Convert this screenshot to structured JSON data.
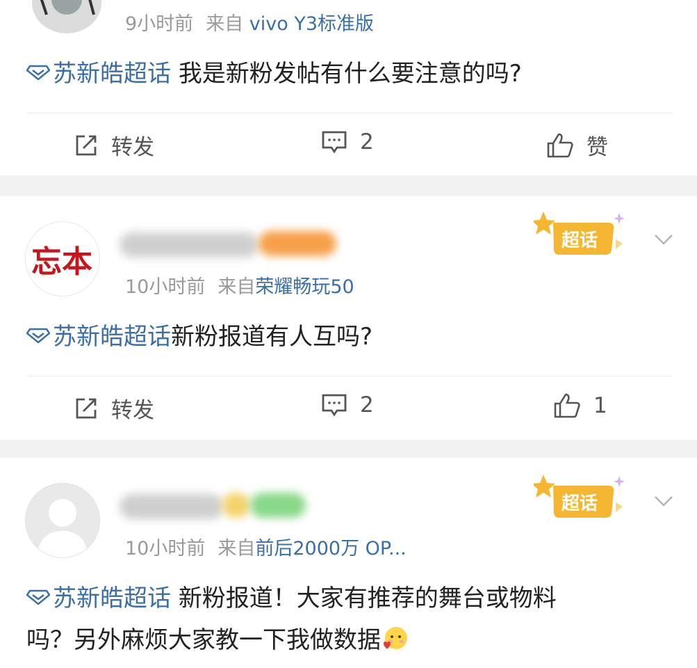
{
  "posts": [
    {
      "meta": {
        "time": "9小时前",
        "from": "来自",
        "source": "vivo Y3标准版"
      },
      "topic": "苏新皓超话",
      "text": "我是新粉发帖有什么要注意的吗?",
      "actions": {
        "repost": "转发",
        "comment": "2",
        "like": "赞"
      }
    },
    {
      "avatar_text": "忘本",
      "meta": {
        "time": "10小时前",
        "from": "来自",
        "source": "荣耀畅玩50"
      },
      "badge": "超话",
      "topic": "苏新皓超话",
      "text": "新粉报道有人互吗?",
      "actions": {
        "repost": "转发",
        "comment": "2",
        "like": "1"
      }
    },
    {
      "meta": {
        "time": "10小时前",
        "from": "来自",
        "source": "前后2000万 OP..."
      },
      "badge": "超话",
      "topic": "苏新皓超话",
      "text_line1": "新粉报道！大家有推荐的舞台或物料",
      "text_line2": "吗？另外麻烦大家教一下我做数据"
    }
  ],
  "colors": {
    "link": "#3a6fa8",
    "meta": "#9a9a9a",
    "badge": "#f5b731"
  }
}
